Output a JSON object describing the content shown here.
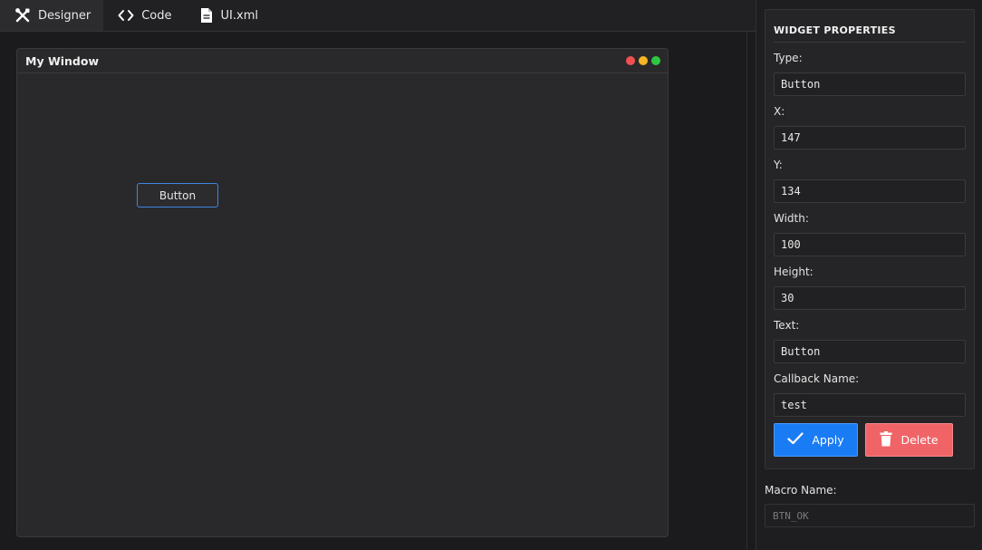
{
  "tabs": [
    {
      "label": "Designer",
      "icon": "tools-icon",
      "active": true
    },
    {
      "label": "Code",
      "icon": "code-brackets-icon",
      "active": false
    },
    {
      "label": "UI.xml",
      "icon": "file-icon",
      "active": false
    }
  ],
  "design_window": {
    "title": "My Window",
    "controls": [
      {
        "name": "close",
        "color": "#f0504f"
      },
      {
        "name": "minimize",
        "color": "#f5b524"
      },
      {
        "name": "maximize",
        "color": "#2ec840"
      }
    ],
    "widget": {
      "label": "Button"
    }
  },
  "properties": {
    "heading": "WIDGET PROPERTIES",
    "fields": [
      {
        "label": "Type:",
        "value": "Button"
      },
      {
        "label": "X:",
        "value": "147"
      },
      {
        "label": "Y:",
        "value": "134"
      },
      {
        "label": "Width:",
        "value": "100"
      },
      {
        "label": "Height:",
        "value": "30"
      },
      {
        "label": "Text:",
        "value": "Button"
      },
      {
        "label": "Callback Name:",
        "value": "test"
      }
    ],
    "apply_label": "Apply",
    "delete_label": "Delete"
  },
  "macro": {
    "label": "Macro Name:",
    "placeholder": "BTN_OK"
  },
  "colors": {
    "accent": "#1a7cf5",
    "danger": "#f06467",
    "selection_border": "#3f86e0"
  }
}
